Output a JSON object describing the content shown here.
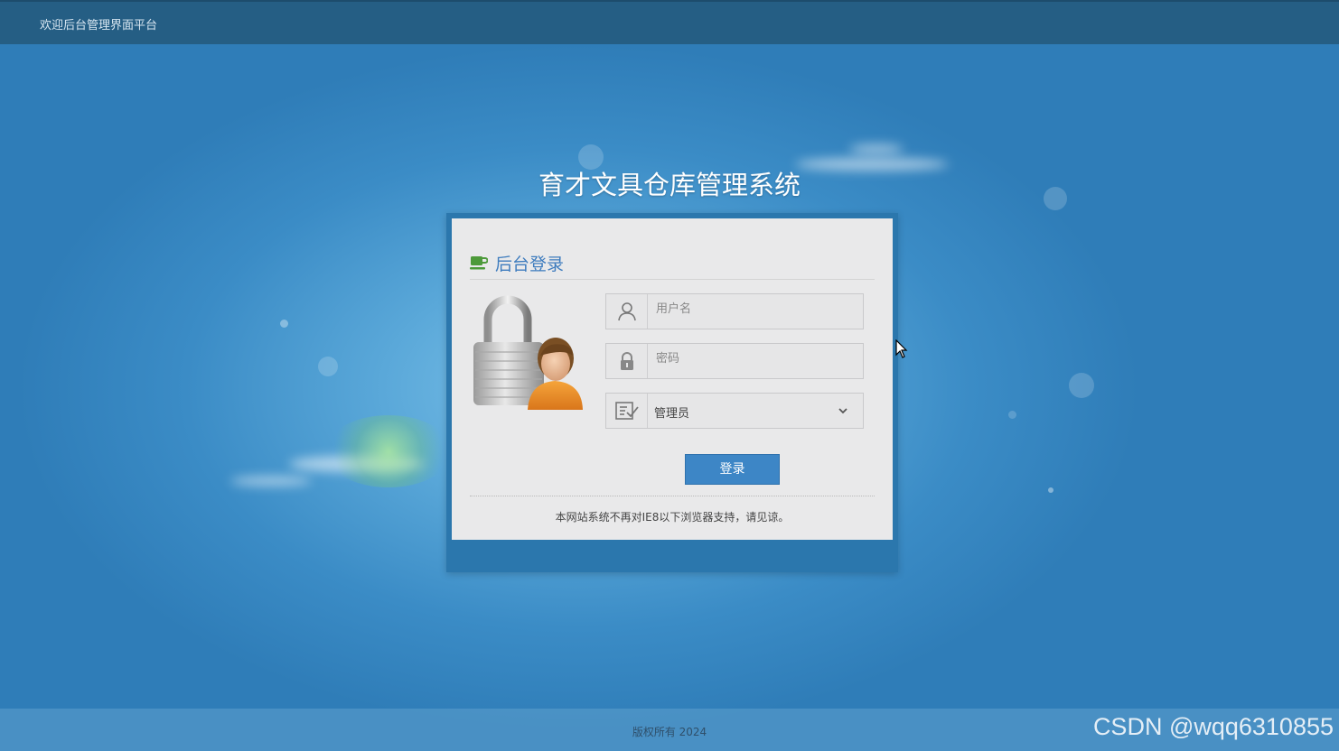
{
  "topbar": {
    "welcome": "欢迎后台管理界面平台"
  },
  "system_title": "育才文具仓库管理系统",
  "login_panel": {
    "heading": "后台登录",
    "username": {
      "placeholder": "用户名",
      "value": ""
    },
    "password": {
      "placeholder": "密码",
      "value": ""
    },
    "role_select": {
      "selected": "管理员"
    },
    "login_button": "登录",
    "notice": "本网站系统不再对IE8以下浏览器支持，请见谅。"
  },
  "footer": {
    "copyright": "版权所有 2024"
  },
  "watermark": "CSDN @wqq6310855",
  "icons": [
    "coffee-cup-icon",
    "padlock-user-icon",
    "user-icon",
    "lock-icon",
    "checklist-icon",
    "chevron-down-icon",
    "mouse-cursor-icon"
  ],
  "colors": {
    "topbar": "#255e84",
    "panel_frame": "#2b77ad",
    "accent": "#3d86c6",
    "heading": "#3e7cbe"
  }
}
